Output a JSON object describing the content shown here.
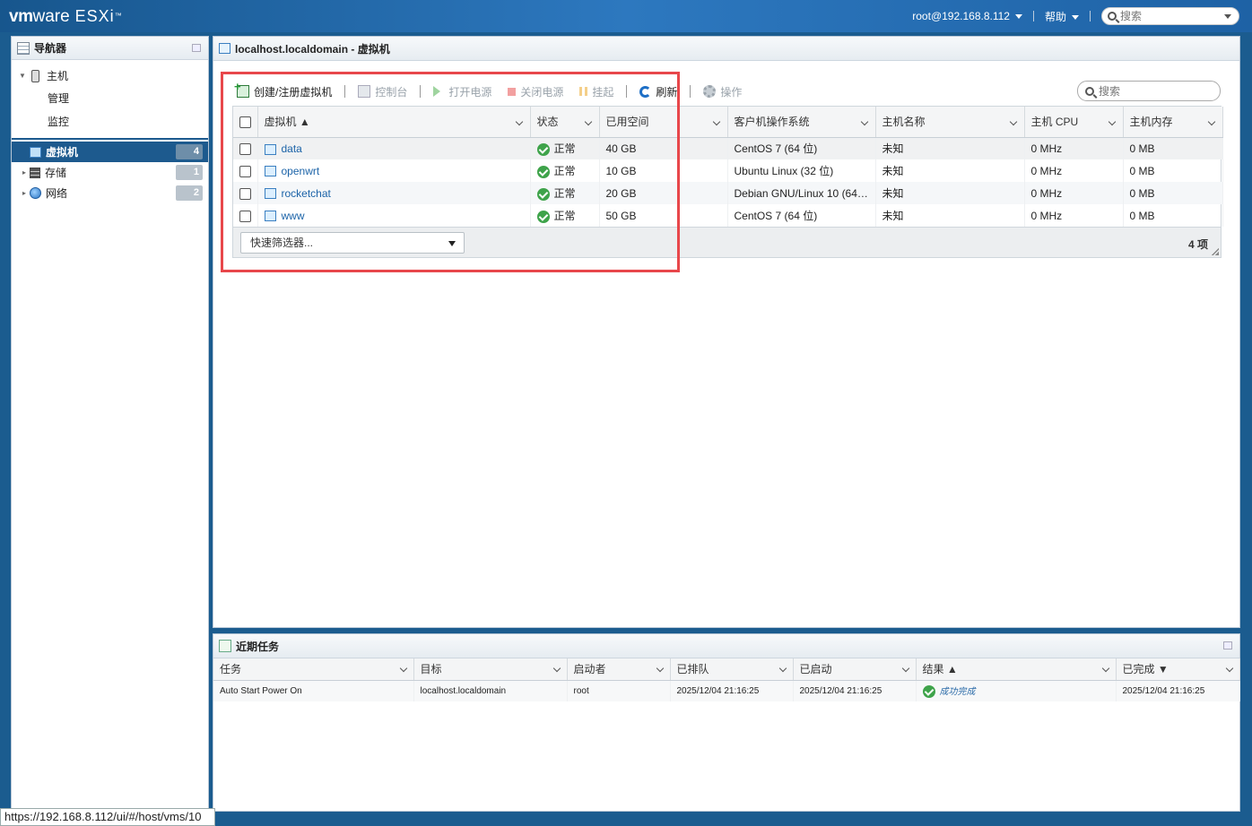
{
  "brand": {
    "vm": "vm",
    "ware": "ware",
    "esxi": "ESXi"
  },
  "topbar": {
    "user": "root@192.168.8.112",
    "help": "帮助",
    "search_placeholder": "搜索"
  },
  "navigator": {
    "title": "导航器",
    "host": "主机",
    "host_children": [
      "管理",
      "监控"
    ],
    "items": [
      {
        "label": "虚拟机",
        "count": "4",
        "selected": true
      },
      {
        "label": "存储",
        "count": "1"
      },
      {
        "label": "网络",
        "count": "2"
      }
    ]
  },
  "main": {
    "title": "localhost.localdomain - 虚拟机",
    "toolbar": {
      "create": "创建/注册虚拟机",
      "console": "控制台",
      "power_on": "打开电源",
      "power_off": "关闭电源",
      "suspend": "挂起",
      "refresh": "刷新",
      "actions": "操作",
      "search_placeholder": "搜索"
    },
    "columns": [
      "虚拟机 ▲",
      "状态",
      "已用空间",
      "客户机操作系统",
      "主机名称",
      "主机 CPU",
      "主机内存"
    ],
    "rows": [
      {
        "name": "data",
        "status": "正常",
        "space": "40 GB",
        "os": "CentOS 7 (64 位)",
        "hostname": "未知",
        "cpu": "0 MHz",
        "mem": "0 MB"
      },
      {
        "name": "openwrt",
        "status": "正常",
        "space": "10 GB",
        "os": "Ubuntu Linux (32 位)",
        "hostname": "未知",
        "cpu": "0 MHz",
        "mem": "0 MB"
      },
      {
        "name": "rocketchat",
        "status": "正常",
        "space": "20 GB",
        "os": "Debian GNU/Linux 10 (64…",
        "hostname": "未知",
        "cpu": "0 MHz",
        "mem": "0 MB"
      },
      {
        "name": "www",
        "status": "正常",
        "space": "50 GB",
        "os": "CentOS 7 (64 位)",
        "hostname": "未知",
        "cpu": "0 MHz",
        "mem": "0 MB"
      }
    ],
    "quick_filter": "快速筛选器...",
    "count": "4 项"
  },
  "tasks": {
    "title": "近期任务",
    "columns": [
      "任务",
      "目标",
      "启动者",
      "已排队",
      "已启动",
      "结果 ▲",
      "已完成 ▼"
    ],
    "rows": [
      {
        "task": "Auto Start Power On",
        "target": "localhost.localdomain",
        "initiator": "root",
        "queued": "2025/12/04 21:16:25",
        "started": "2025/12/04 21:16:25",
        "result": "成功完成",
        "completed": "2025/12/04 21:16:25"
      }
    ]
  },
  "statusbar": {
    "url": "https://192.168.8.112/ui/#/host/vms/10"
  },
  "colors": {
    "topbar": "#2d78bf",
    "selected": "#1d5a8e",
    "highlight_box": "#e8474b",
    "ok": "#3ea34a"
  }
}
